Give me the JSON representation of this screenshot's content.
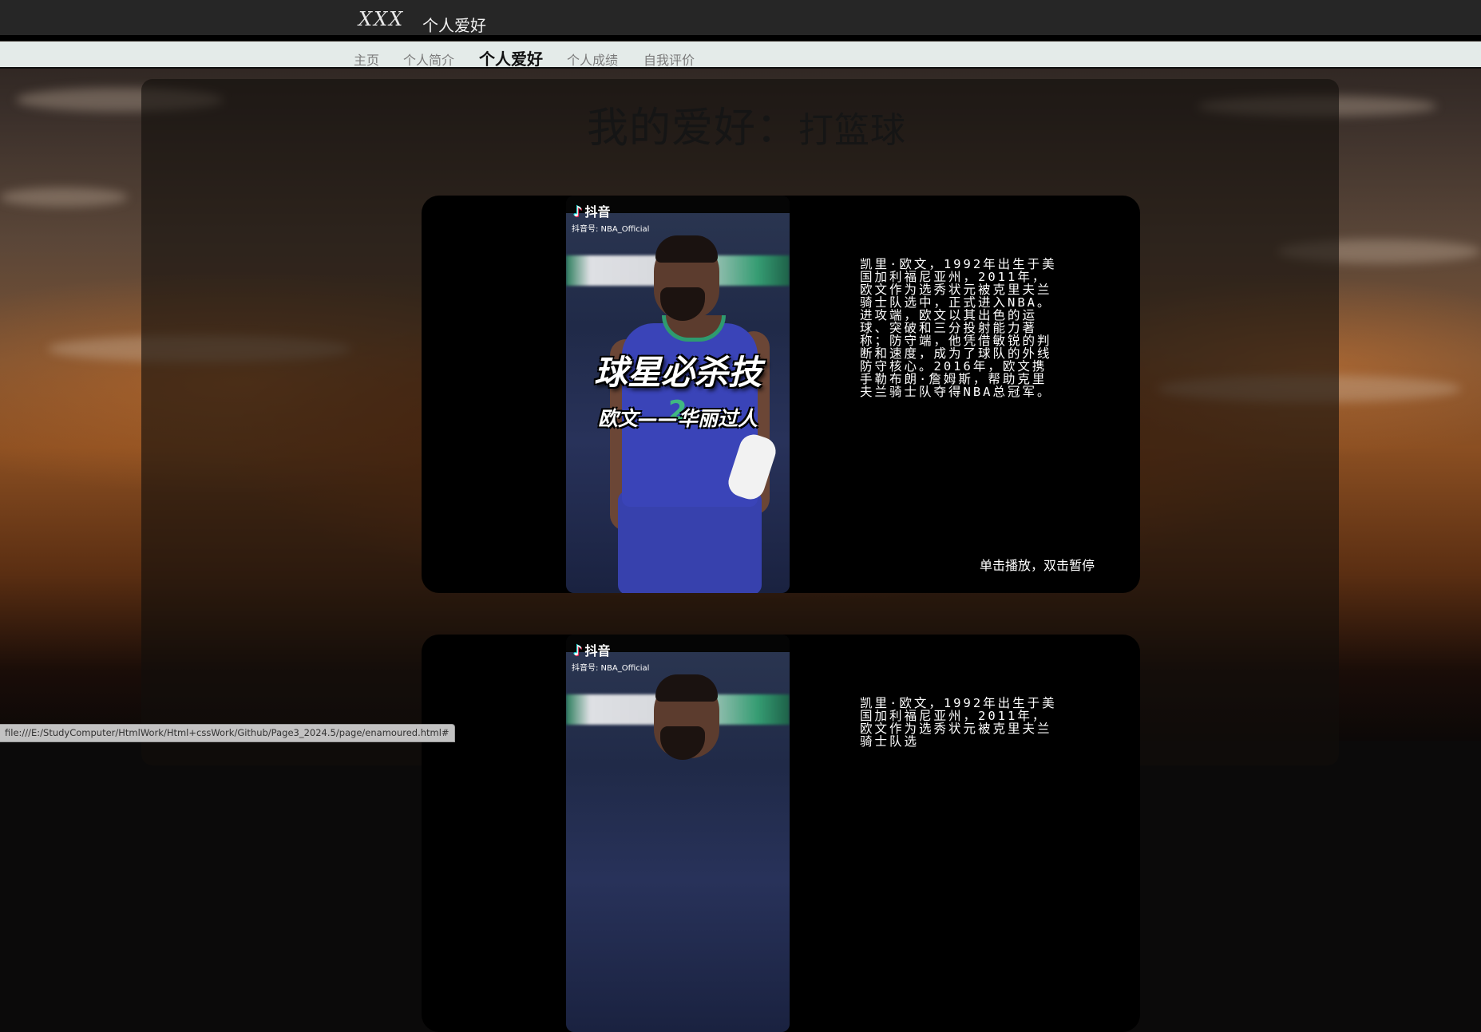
{
  "header": {
    "logo_text": "XXX",
    "site_title": "个人爱好"
  },
  "nav": {
    "items": [
      {
        "label": "主页",
        "active": false
      },
      {
        "label": "个人简介",
        "active": false
      },
      {
        "label": "个人爱好",
        "active": true
      },
      {
        "label": "个人成绩",
        "active": false
      },
      {
        "label": "自我评价",
        "active": false
      }
    ]
  },
  "main": {
    "title_main": "我的爱好：",
    "title_sub": "打篮球"
  },
  "video_cards": [
    {
      "platform_name": "抖音",
      "platform_icon": "tiktok-icon",
      "account_id": "抖音号: NBA_Official",
      "overlay_title": "球星必杀技",
      "overlay_subtitle": "欧文——华丽过人",
      "jersey_number": "2",
      "description": "凯里·欧文，1992年出生于美国加利福尼亚州，2011年，欧文作为选秀状元被克里夫兰骑士队选中，正式进入NBA。进攻端，欧文以其出色的运球、突破和三分投射能力著称；防守端，他凭借敏锐的判断和速度，成为了球队的外线防守核心。2016年，欧文携手勒布朗·詹姆斯，帮助克里夫兰骑士队夺得NBA总冠军。",
      "hint": "单击播放，双击暂停"
    },
    {
      "platform_name": "抖音",
      "platform_icon": "tiktok-icon",
      "account_id": "抖音号: NBA_Official",
      "description": "凯里·欧文，1992年出生于美国加利福尼亚州，2011年，欧文作为选秀状元被克里夫兰骑士队选"
    }
  ],
  "status_bar": {
    "url": "file:///E:/StudyComputer/HtmlWork/Html+cssWork/Github/Page3_2024.5/page/enamoured.html#"
  },
  "colors": {
    "topbar": "#262626",
    "navbar": "#e4ebe9",
    "card": "#000000"
  }
}
